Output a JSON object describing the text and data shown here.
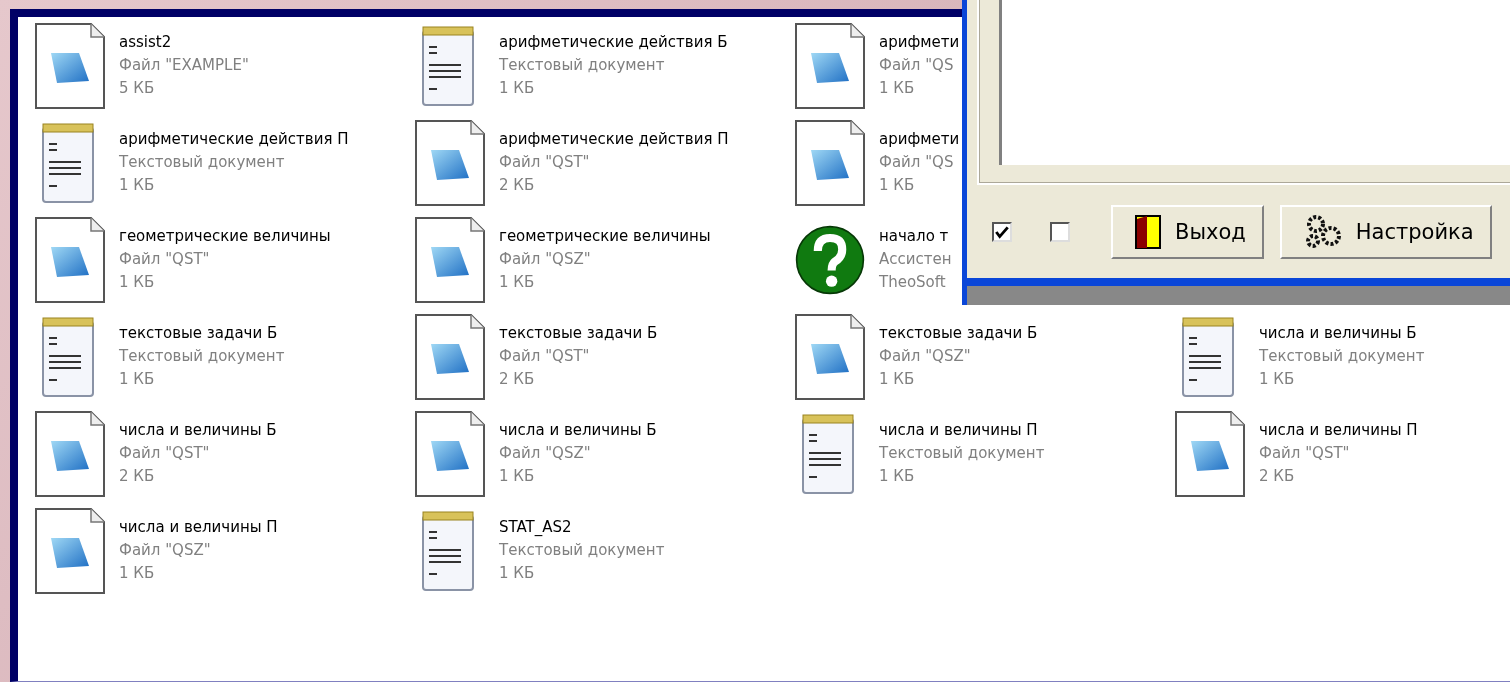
{
  "files": [
    {
      "kind": "qst",
      "name": "assist2",
      "type": "Файл \"EXAMPLE\"",
      "size": "5 КБ"
    },
    {
      "kind": "txt",
      "name": "арифметические действия Б",
      "type": "Текстовый документ",
      "size": "1 КБ"
    },
    {
      "kind": "qst",
      "name": "арифмети",
      "type": "Файл \"QS",
      "size": "1 КБ"
    },
    {
      "kind": "none"
    },
    {
      "kind": "txt",
      "name": "арифметические действия П",
      "type": "Текстовый документ",
      "size": "1 КБ"
    },
    {
      "kind": "qst",
      "name": "арифметические действия П",
      "type": "Файл \"QST\"",
      "size": "2 КБ"
    },
    {
      "kind": "qst",
      "name": "арифмети",
      "type": "Файл \"QS",
      "size": "1 КБ"
    },
    {
      "kind": "none"
    },
    {
      "kind": "qst",
      "name": "геометрические величины",
      "type": "Файл \"QST\"",
      "size": "1 КБ"
    },
    {
      "kind": "qst",
      "name": "геометрические величины",
      "type": "Файл \"QSZ\"",
      "size": "1 КБ"
    },
    {
      "kind": "app",
      "name": "начало т",
      "type": "Ассистен",
      "size": "TheoSoft"
    },
    {
      "kind": "none"
    },
    {
      "kind": "txt",
      "name": "текстовые задачи Б",
      "type": "Текстовый документ",
      "size": "1 КБ"
    },
    {
      "kind": "qst",
      "name": "текстовые задачи Б",
      "type": "Файл \"QST\"",
      "size": "2 КБ"
    },
    {
      "kind": "qst",
      "name": "текстовые задачи Б",
      "type": "Файл \"QSZ\"",
      "size": "1 КБ"
    },
    {
      "kind": "txt",
      "name": "числа и величины Б",
      "type": "Текстовый документ",
      "size": "1 КБ"
    },
    {
      "kind": "qst",
      "name": "числа и величины Б",
      "type": "Файл \"QST\"",
      "size": "2 КБ"
    },
    {
      "kind": "qst",
      "name": "числа и величины Б",
      "type": "Файл \"QSZ\"",
      "size": "1 КБ"
    },
    {
      "kind": "txt",
      "name": "числа и величины П",
      "type": "Текстовый документ",
      "size": "1 КБ"
    },
    {
      "kind": "qst",
      "name": "числа и величины П",
      "type": "Файл \"QST\"",
      "size": "2 КБ"
    },
    {
      "kind": "qst",
      "name": "числа и величины П",
      "type": "Файл \"QSZ\"",
      "size": "1 КБ"
    },
    {
      "kind": "txt",
      "name": "STAT_AS2",
      "type": "Текстовый документ",
      "size": "1 КБ"
    }
  ],
  "dialog": {
    "checkboxes": [
      {
        "checked": true
      },
      {
        "checked": false
      }
    ],
    "buttons": [
      {
        "kind": "exit",
        "label": "Выход"
      },
      {
        "kind": "settings",
        "label": "Настройка"
      }
    ]
  }
}
